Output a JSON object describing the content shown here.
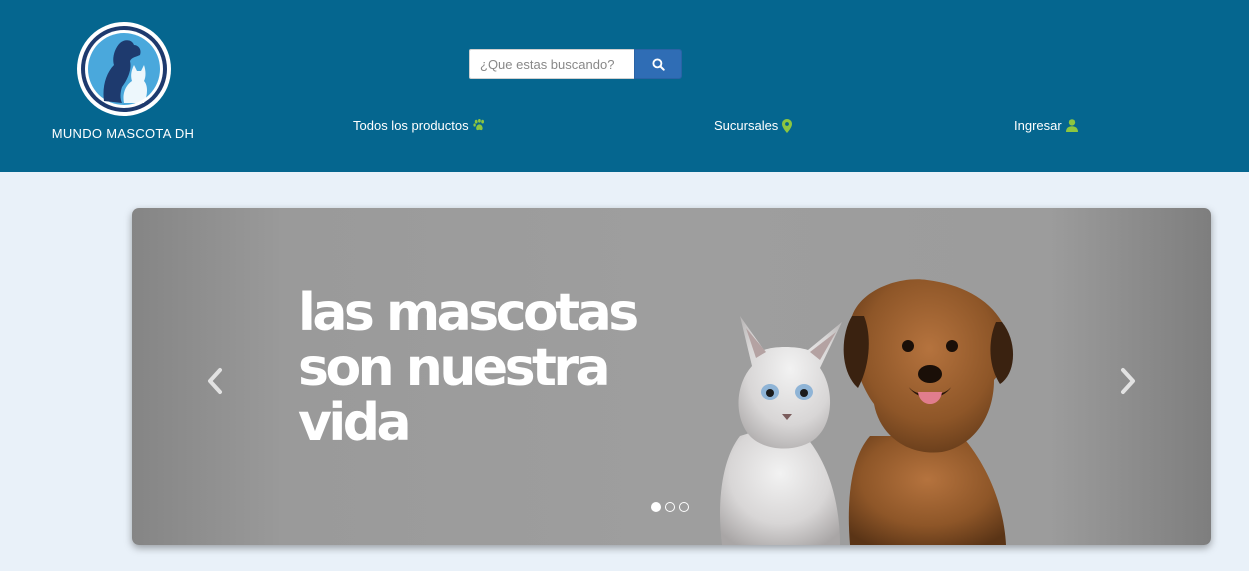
{
  "header": {
    "brand_name": "MUNDO MASCOTA DH",
    "search": {
      "placeholder": "¿Que estas buscando?"
    },
    "nav": {
      "products": "Todos los productos",
      "branches": "Sucursales",
      "login": "Ingresar"
    },
    "colors": {
      "background": "#05668f",
      "icon_accent": "#8dc63f",
      "search_button": "#2f6db5"
    }
  },
  "carousel": {
    "slide_text": [
      "las mascotas",
      "son nuestra",
      "vida"
    ],
    "slide_count": 3,
    "active_index": 0
  },
  "page": {
    "background": "#e9f1f9"
  }
}
